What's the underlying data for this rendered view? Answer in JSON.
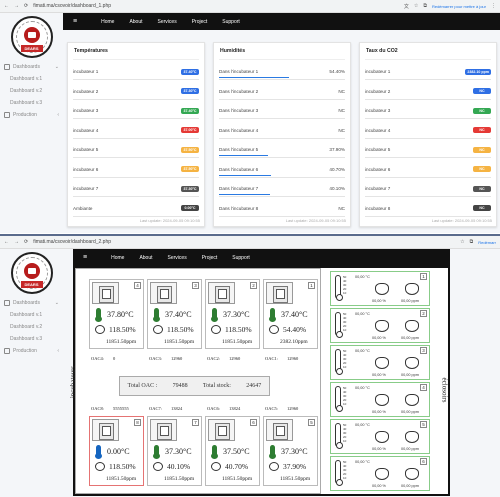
{
  "w1": {
    "url": "fimati.ma/csovoir/dashboard_1.php",
    "browser_btn": "Redémarrer pour mettre à jour",
    "logo_text": "DEARS",
    "nav": [
      {
        "label": "Dashboards"
      },
      {
        "label": "Dashboard v.1"
      },
      {
        "label": "Dashboard v.2"
      },
      {
        "label": "Dashboard v.3"
      },
      {
        "label": "Production"
      }
    ],
    "menu": [
      "Home",
      "About",
      "Services",
      "Project",
      "Support"
    ],
    "temps": {
      "title": "Températures",
      "rows": [
        {
          "label": "incubateur 1",
          "value": "37.40°C",
          "color": "#2f6fe4"
        },
        {
          "label": "incubateur 2",
          "value": "37.30°C",
          "color": "#2f6fe4"
        },
        {
          "label": "incubateur 3",
          "value": "37.40°C",
          "color": "#34a853"
        },
        {
          "label": "incubateur 4",
          "value": "37.00°C",
          "color": "#e53935"
        },
        {
          "label": "incubateur 5",
          "value": "37.50°C",
          "color": "#f5b342"
        },
        {
          "label": "incubateur 6",
          "value": "37.50°C",
          "color": "#f5b342"
        },
        {
          "label": "incubateur 7",
          "value": "37.30°C",
          "color": "#555555"
        },
        {
          "label": "Ambiante",
          "value": "0.00°C",
          "color": "#444444"
        }
      ],
      "footer": "Last update: 2024-09-05 09:10:55"
    },
    "hum": {
      "title": "Humidités",
      "rows": [
        {
          "label": "Dans l'incubateur 1",
          "value": "54.40%",
          "pct": 54.4
        },
        {
          "label": "Dans l'incubateur 2",
          "value": "NC",
          "pct": 0
        },
        {
          "label": "Dans l'incubateur 3",
          "value": "NC",
          "pct": 0
        },
        {
          "label": "Dans l'incubateur 4",
          "value": "NC",
          "pct": 0
        },
        {
          "label": "Dans l'incubateur 5",
          "value": "37.90%",
          "pct": 37.9
        },
        {
          "label": "Dans l'incubateur 6",
          "value": "40.70%",
          "pct": 40.7
        },
        {
          "label": "Dans l'incubateur 7",
          "value": "40.10%",
          "pct": 40.1
        },
        {
          "label": "Dans l'incubateur 8",
          "value": "NC",
          "pct": 0
        }
      ],
      "footer": "Last update: 2024-09-05 09:10:55"
    },
    "co2": {
      "title": "Taux du CO2",
      "rows": [
        {
          "label": "incubateur 1",
          "value": "2382.10 ppm",
          "color": "#2f6fe4"
        },
        {
          "label": "incubateur 2",
          "value": "NC",
          "color": "#2f6fe4"
        },
        {
          "label": "incubateur 3",
          "value": "NC",
          "color": "#34a853"
        },
        {
          "label": "incubateur 4",
          "value": "NC",
          "color": "#e53935"
        },
        {
          "label": "incubateur 5",
          "value": "NC",
          "color": "#f5b342"
        },
        {
          "label": "incubateur 6",
          "value": "NC",
          "color": "#f5b342"
        },
        {
          "label": "incubateur 7",
          "value": "NC",
          "color": "#555555"
        },
        {
          "label": "incubateur 8",
          "value": "NC",
          "color": "#444444"
        }
      ],
      "footer": "Last update: 2024-09-05 09:10:55"
    }
  },
  "w2": {
    "url": "fimati.ma/csovoir/dashboard_2.php",
    "browser_btn": "Redémarr",
    "logo_text": "DEARS",
    "nav": [
      {
        "label": "Dashboards"
      },
      {
        "label": "Dashboard v.1"
      },
      {
        "label": "Dashboard v.2"
      },
      {
        "label": "Dashboard v.3"
      },
      {
        "label": "Production"
      }
    ],
    "menu": [
      "Home",
      "About",
      "Services",
      "Project",
      "Support"
    ],
    "side_label": "incubateurs",
    "side_label2": "éclosoirs",
    "top_incs": [
      {
        "num": "4",
        "temp": "37.80°C",
        "hum": "118.50%",
        "co2": "11851.50ppm",
        "oac_label": "OAC4:",
        "oac": "0"
      },
      {
        "num": "3",
        "temp": "37.40°C",
        "hum": "118.50%",
        "co2": "11851.50ppm",
        "oac_label": "OAC3:",
        "oac": "12960"
      },
      {
        "num": "2",
        "temp": "37.30°C",
        "hum": "118.50%",
        "co2": "11851.50ppm",
        "oac_label": "OAC2:",
        "oac": "12960"
      },
      {
        "num": "1",
        "temp": "37.40°C",
        "hum": "54.40%",
        "co2": "2382.10ppm",
        "oac_label": "OAC1:",
        "oac": "12960"
      }
    ],
    "total_oac_label": "Total OAC :",
    "total_oac": "79488",
    "total_stock_label": "Total stock:",
    "total_stock": "24647",
    "bottom_oac": [
      {
        "label": "OAC8:",
        "value": "5555555"
      },
      {
        "label": "OAC7:",
        "value": "13824"
      },
      {
        "label": "OAC6:",
        "value": "13824"
      },
      {
        "label": "OAC5:",
        "value": "12960"
      }
    ],
    "bottom_incs": [
      {
        "num": "8",
        "temp": "0.00°C",
        "hum": "118.50%",
        "co2": "11851.50ppm",
        "therm": "blue"
      },
      {
        "num": "7",
        "temp": "37.30°C",
        "hum": "40.10%",
        "co2": "11851.50ppm",
        "therm": "green"
      },
      {
        "num": "6",
        "temp": "37.50°C",
        "hum": "40.70%",
        "co2": "11851.50ppm",
        "therm": "green"
      },
      {
        "num": "5",
        "temp": "37.30°C",
        "hum": "37.90%",
        "co2": "11851.50ppm",
        "therm": "green"
      }
    ],
    "enclosures": [
      {
        "temp": "00,00 °C",
        "hum": "00,00 %",
        "co2": "00,00 ppm",
        "num": "1",
        "scale": [
          "50",
          "40",
          "30",
          "20",
          "10"
        ]
      },
      {
        "temp": "00,00 °C",
        "hum": "00,00 %",
        "co2": "00,00 ppm",
        "num": "2",
        "scale": [
          "50",
          "40",
          "30",
          "20",
          "10"
        ]
      },
      {
        "temp": "00,00 °C",
        "hum": "00,00 %",
        "co2": "00,00 ppm",
        "num": "3",
        "scale": [
          "50",
          "40",
          "30",
          "20",
          "10"
        ]
      },
      {
        "temp": "00,00 °C",
        "hum": "00,00 %",
        "co2": "00,00 ppm",
        "num": "4",
        "scale": [
          "50",
          "40",
          "30",
          "20",
          "10"
        ]
      },
      {
        "temp": "00,00 °C",
        "hum": "00,00 %",
        "co2": "00,00 ppm",
        "num": "5",
        "scale": [
          "50",
          "40",
          "30",
          "20",
          "10"
        ]
      },
      {
        "temp": "00,00 °C",
        "hum": "00,00 %",
        "co2": "00,00 ppm",
        "num": "6",
        "scale": [
          "50",
          "40",
          "30",
          "20",
          "10"
        ]
      }
    ]
  }
}
